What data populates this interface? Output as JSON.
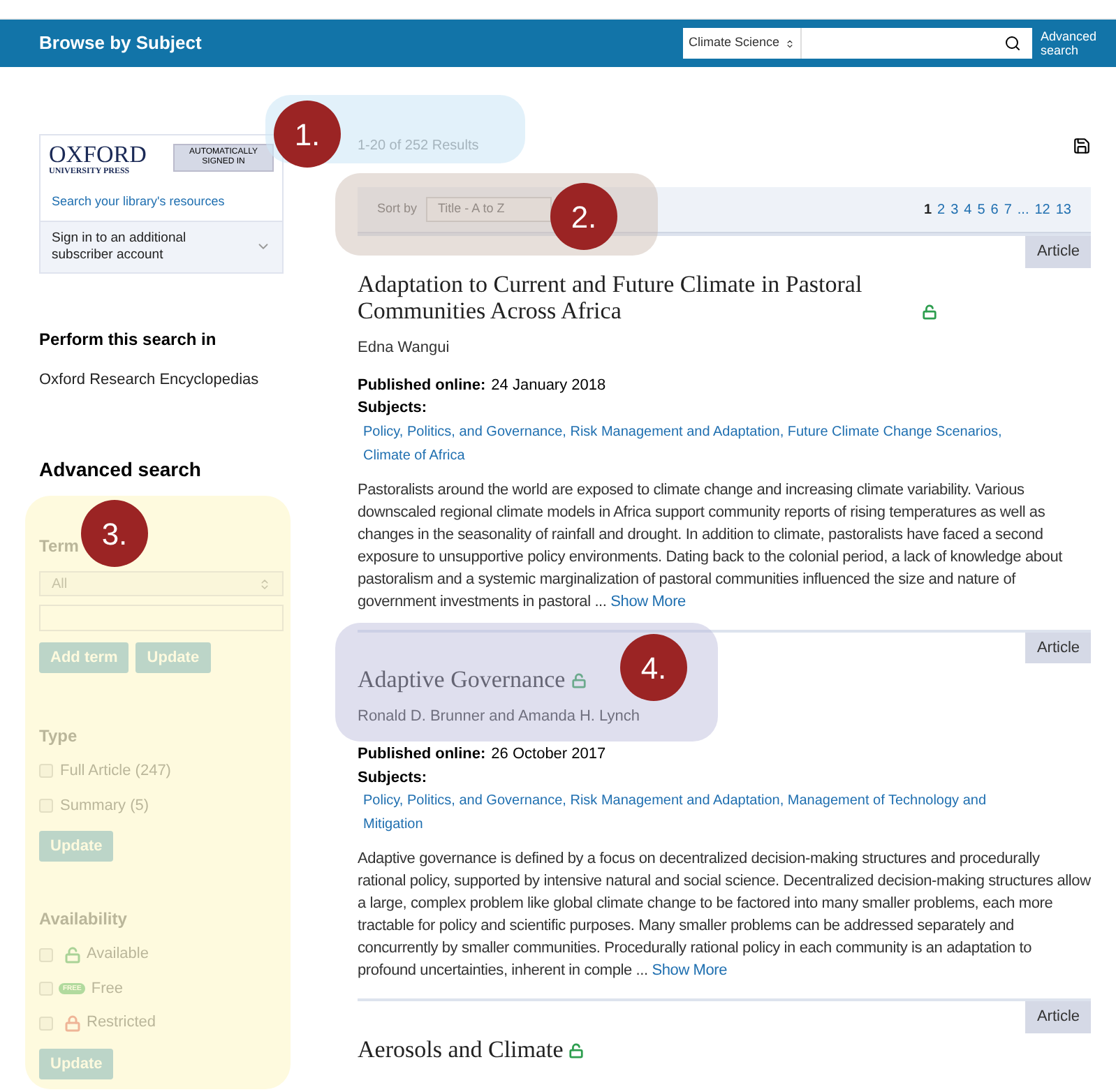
{
  "header": {
    "title": "Browse by Subject",
    "scope": "Climate Science",
    "advanced_search": "Advanced search"
  },
  "institution": {
    "logo_name": "OXFORD",
    "logo_sub": "UNIVERSITY PRESS",
    "status": "AUTOMATICALLY SIGNED IN",
    "library_link": "Search your library's resources",
    "signin": "Sign in to an additional subscriber account",
    "expanded": false
  },
  "perform": {
    "heading": "Perform this search in",
    "link": "Oxford Research Encyclopedias"
  },
  "advanced": {
    "heading": "Advanced search",
    "term": {
      "label": "Term",
      "select": "All",
      "buttons": [
        "Add term",
        "Update"
      ]
    },
    "type": {
      "label": "Type",
      "options": [
        {
          "label": "Full Article (247)",
          "checked": false
        },
        {
          "label": "Summary (5)",
          "checked": false
        }
      ],
      "button": "Update"
    },
    "availability": {
      "label": "Availability",
      "options": [
        {
          "kind": "open",
          "label": "Available",
          "checked": false
        },
        {
          "kind": "free",
          "badge": "FREE",
          "label": "Free",
          "checked": false
        },
        {
          "kind": "restricted",
          "label": "Restricted",
          "checked": false
        }
      ],
      "button": "Update"
    }
  },
  "results": {
    "count": "1-20 of 252 Results",
    "sort_label": "Sort by",
    "sort_value": "Title - A to Z",
    "pages": [
      {
        "label": "1",
        "selected": true
      },
      {
        "label": "2",
        "selected": false
      },
      {
        "label": "3",
        "selected": false
      },
      {
        "label": "4",
        "selected": false
      },
      {
        "label": "5",
        "selected": false
      },
      {
        "label": "6",
        "selected": false
      },
      {
        "label": "7",
        "selected": false
      },
      {
        "label": "...",
        "selected": false
      },
      {
        "label": "12",
        "selected": false
      },
      {
        "label": "13",
        "selected": false
      }
    ],
    "items": [
      {
        "type": "Article",
        "title": "Adaptation to Current and Future Climate in Pastoral Communities Across Africa",
        "open_access": true,
        "authors": "Edna Wangui",
        "published_label": "Published online:",
        "published": "24 January 2018",
        "subjects_label": "Subjects:",
        "subjects": "Policy, Politics, and Governance, Risk Management and Adaptation, Future Climate Change Scenarios, Climate of Africa",
        "abstract": "Pastoralists around the world are exposed to climate change and increasing climate variability. Various downscaled regional climate models in Africa support community reports of rising temperatures as well as changes in the seasonality of rainfall and drought. In addition to climate, pastoralists have faced a second exposure to unsupportive policy environments. Dating back to the colonial period, a lack of knowledge about pastoralism and a systemic marginalization of pastoral communities influenced the size and nature of government investments in pastoral ...",
        "show_more": "Show More"
      },
      {
        "type": "Article",
        "title": "Adaptive Governance",
        "open_access": true,
        "authors": "Ronald D. Brunner and Amanda H. Lynch",
        "published_label": "Published online:",
        "published": "26 October 2017",
        "subjects_label": "Subjects:",
        "subjects": "Policy, Politics, and Governance, Risk Management and Adaptation, Management of Technology and Mitigation",
        "abstract": "Adaptive governance is defined by a focus on decentralized decision-making structures and procedurally rational policy, supported by intensive natural and social science. Decentralized decision-making structures allow a large, complex problem like global climate change to be factored into many smaller problems, each more tractable for policy and scientific purposes. Many smaller problems can be addressed separately and concurrently by smaller communities. Procedurally rational policy in each community is an adaptation to profound uncertainties, inherent in comple ...",
        "show_more": "Show More"
      },
      {
        "type": "Article",
        "title": "Aerosols and Climate",
        "open_access": true
      }
    ]
  },
  "callouts": [
    {
      "label": "1."
    },
    {
      "label": "2."
    },
    {
      "label": "3."
    },
    {
      "label": "4."
    }
  ]
}
